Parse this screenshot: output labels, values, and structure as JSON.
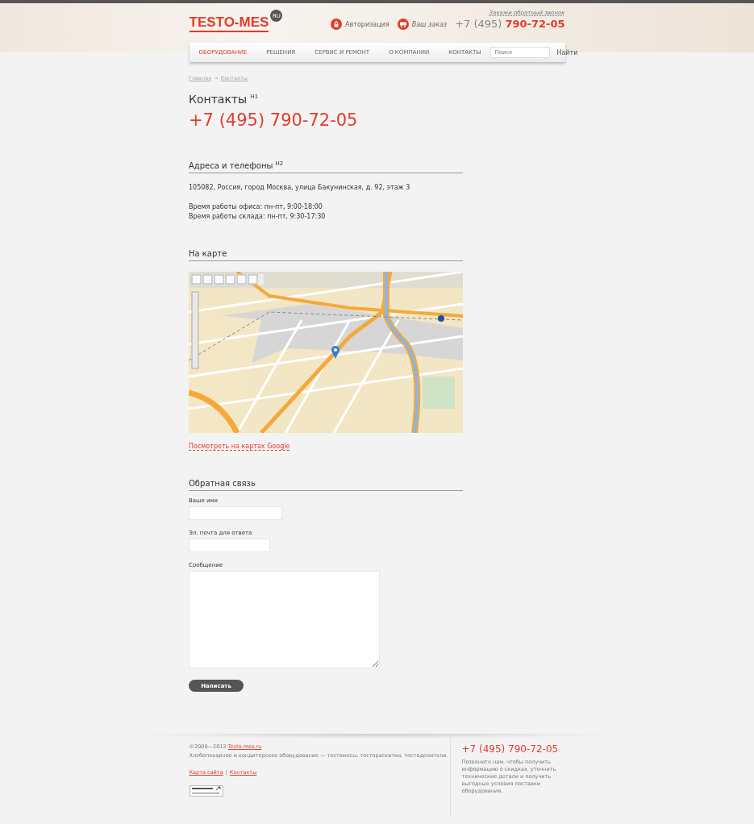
{
  "header": {
    "logo": "TESTO-MES",
    "logo_badge": "RU",
    "links": [
      {
        "kind": "lock",
        "label": "Авторизация"
      },
      {
        "kind": "cart",
        "label": "Ваш заказ"
      }
    ],
    "callback": "Закажи обратный звонок",
    "phone_code": "+7 (495)",
    "phone_number": "790-72-05"
  },
  "nav": {
    "items": [
      {
        "label": "ОБОРУДОВАНИЕ",
        "selected": true
      },
      {
        "label": "РЕШЕНИЯ",
        "selected": false
      },
      {
        "label": "СЕРВИС И РЕМОНТ",
        "selected": false
      },
      {
        "label": "О КОМПАНИИ",
        "selected": false
      },
      {
        "label": "КОНТАКТЫ",
        "selected": false
      }
    ],
    "search": {
      "placeholder": "Поиск",
      "button": "Найти"
    }
  },
  "breadcrumbs": [
    "Главная",
    "→",
    "Контакты"
  ],
  "page_title": "Контакты $^{H1}$",
  "phone": "+7 (495) 790-72-05",
  "sections": [
    {
      "kind": "text",
      "title": "Адреса и телефоны $^{H2}$",
      "paragraphs": [
        [
          "105082, Россия, город Москва, улица Бакунинская, д. 92, этаж 3"
        ],
        [
          "Время работы офиса: пн-пт, 9:00-18:00",
          "Время работы склада: пн-пт, 9:30-17:30"
        ]
      ]
    },
    {
      "kind": "map",
      "title": "На карте",
      "link": "Посмотреть на картах Google"
    },
    {
      "kind": "form",
      "title": "Обратная связь",
      "fields": [
        {
          "label": "Ваше имя",
          "kind": "short"
        },
        {
          "label": "Эл. почта для ответа",
          "kind": "medium"
        },
        {
          "label": "Сообщение",
          "kind": "area"
        }
      ],
      "submit": "Написать"
    }
  ],
  "footer": {
    "copyright": "©2009—2012",
    "site_link": "Testo-mes.ru",
    "tagline": "Хлебопекарное и кондитерское оборудование — тестомесы, тестораскатки, тестоделители.",
    "links": [
      "Карта сайта",
      "Контакты"
    ],
    "separator": "|",
    "phone": "+7 (495) 790-72-05",
    "note": "Позвоните нам, чтобы получить информацию о скидках, уточнить технические детали и получить выгодные условия поставки оборудования."
  }
}
